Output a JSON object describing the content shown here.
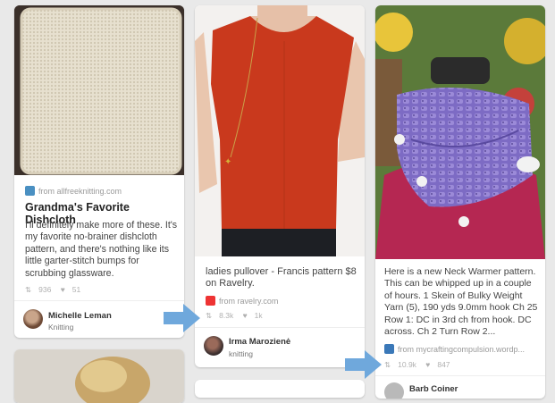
{
  "pins": [
    {
      "source": "from allfreeknitting.com",
      "title": "Grandma's Favorite Dishcloth",
      "description": "I'll definitely make more of these. It's my favorite no-brainer dishcloth pattern, and there's nothing like its little garter-stitch bumps for scrubbing glassware.",
      "repins": "936",
      "likes": "51",
      "user_name": "Michelle Leman",
      "board": "Knitting",
      "image_icon": "dishcloth-photo"
    },
    {
      "description": "ladies pullover - Francis pattern $8 on Ravelry.",
      "source": "from ravelry.com",
      "repins": "8.3k",
      "likes": "1k",
      "user_name": "Irma Marozienė",
      "board": "knitting",
      "image_icon": "red-sweater-photo"
    },
    {
      "description": "Here is a new Neck Warmer pattern. This can be whipped up in a couple of hours. 1 Skein of Bulky Weight Yarn (5), 190 yds 9.0mm hook Ch 25 Row 1: DC in 3rd ch from hook. DC across. Ch 2 Turn Row 2...",
      "source": "from mycraftingcompulsion.wordp...",
      "repins": "10.9k",
      "likes": "847",
      "user_name": "Barb Coiner",
      "image_icon": "neck-warmer-photo"
    }
  ],
  "colors": {
    "background": "#e9e9e9",
    "arrow": "#6fa8dc"
  }
}
